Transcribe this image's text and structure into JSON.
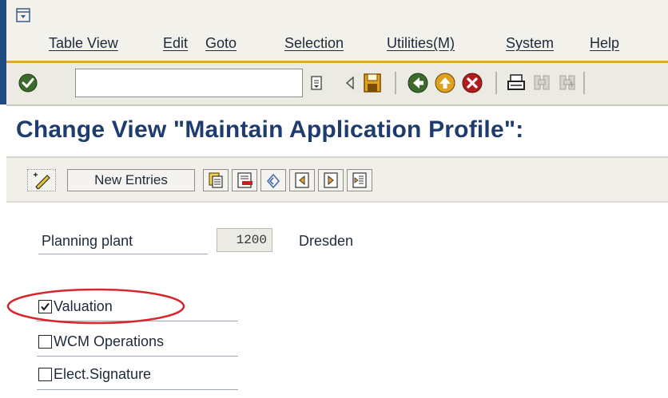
{
  "menu": {
    "items": [
      "Table View",
      "Edit",
      "Goto",
      "Selection",
      "Utilities(M)",
      "System",
      "Help"
    ]
  },
  "toolbar": {
    "command_value": "",
    "icons": [
      "enter-icon",
      "command-history-icon",
      "back-arrow-icon",
      "save-icon",
      "back-icon",
      "exit-icon",
      "cancel-icon",
      "print-icon",
      "find-icon",
      "find-next-icon"
    ]
  },
  "page": {
    "title": "Change View \"Maintain Application Profile\":"
  },
  "app_toolbar": {
    "new_entries_label": "New Entries"
  },
  "form": {
    "planning_plant_label": "Planning plant",
    "planning_plant_value": "1200",
    "planning_plant_name": "Dresden"
  },
  "checkboxes": [
    {
      "label": "Valuation",
      "checked": true
    },
    {
      "label": "WCM Operations",
      "checked": false
    },
    {
      "label": "Elect.Signature",
      "checked": false
    }
  ],
  "colors": {
    "title": "#1e3c6e",
    "menu_line": "#e3a52d",
    "highlight": "#d8262c"
  }
}
